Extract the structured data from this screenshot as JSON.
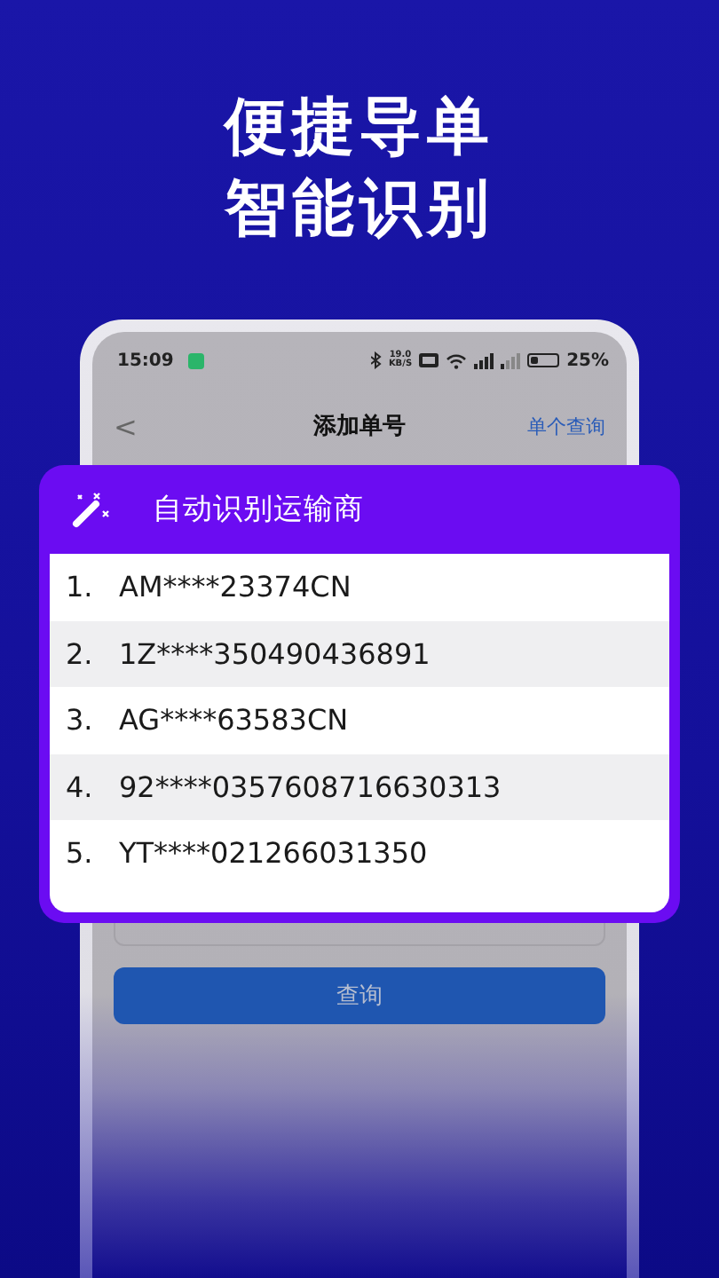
{
  "headline": [
    "便捷导单",
    "智能识别"
  ],
  "status_bar": {
    "time": "15:09",
    "speed_value": "19.0",
    "speed_unit": "KB/S",
    "battery": "25%"
  },
  "nav": {
    "back": "<",
    "title": "添加单号",
    "action": "单个查询"
  },
  "query_button": "查询",
  "popup": {
    "title": "自动识别运输商",
    "items": [
      {
        "number": "1.",
        "code": "AM****23374CN"
      },
      {
        "number": "2.",
        "code": "1Z****350490436891"
      },
      {
        "number": "3.",
        "code": "AG****63583CN"
      },
      {
        "number": "4.",
        "code": "92****0357608716630313"
      },
      {
        "number": "5.",
        "code": "YT****021266031350"
      }
    ]
  }
}
